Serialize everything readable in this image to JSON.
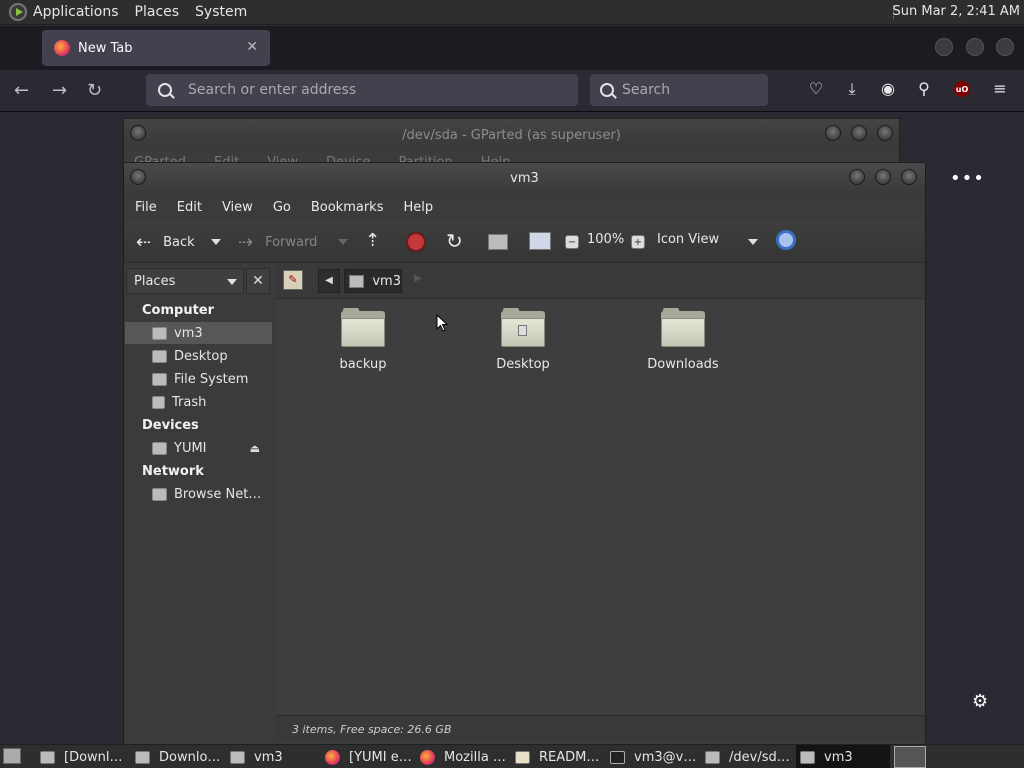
{
  "top_panel": {
    "menus": [
      "Applications",
      "Places",
      "System"
    ],
    "clock": "Sun Mar  2,  2:41 AM"
  },
  "firefox": {
    "tab_title": "New Tab",
    "url_placeholder": "Search or enter address",
    "search_placeholder": "Search",
    "ublock_label": "uO"
  },
  "gparted": {
    "title": "/dev/sda - GParted (as superuser)",
    "menus": [
      "GParted",
      "Edit",
      "View",
      "Device",
      "Partition",
      "Help"
    ]
  },
  "nautilus": {
    "title": "vm3",
    "menus": [
      "File",
      "Edit",
      "View",
      "Go",
      "Bookmarks",
      "Help"
    ],
    "toolbar": {
      "back": "Back",
      "forward": "Forward",
      "zoom": "100%",
      "view_mode": "Icon View"
    },
    "sidebar": {
      "header": "Places",
      "sections": [
        {
          "title": "Computer",
          "items": [
            "vm3",
            "Desktop",
            "File System",
            "Trash"
          ]
        },
        {
          "title": "Devices",
          "items": [
            "YUMI"
          ]
        },
        {
          "title": "Network",
          "items": [
            "Browse Net…"
          ]
        }
      ],
      "selected": "vm3"
    },
    "pathbar": {
      "crumb": "vm3"
    },
    "files": [
      "backup",
      "Desktop",
      "Downloads"
    ],
    "status": "3 items, Free space: 26.6 GB"
  },
  "taskbar": {
    "tasks": [
      "[Downl…",
      "Downlo…",
      "vm3",
      "[YUMI e…",
      "Mozilla …",
      "READM…",
      "vm3@v…",
      "/dev/sd…",
      "vm3"
    ],
    "active": "vm3"
  }
}
